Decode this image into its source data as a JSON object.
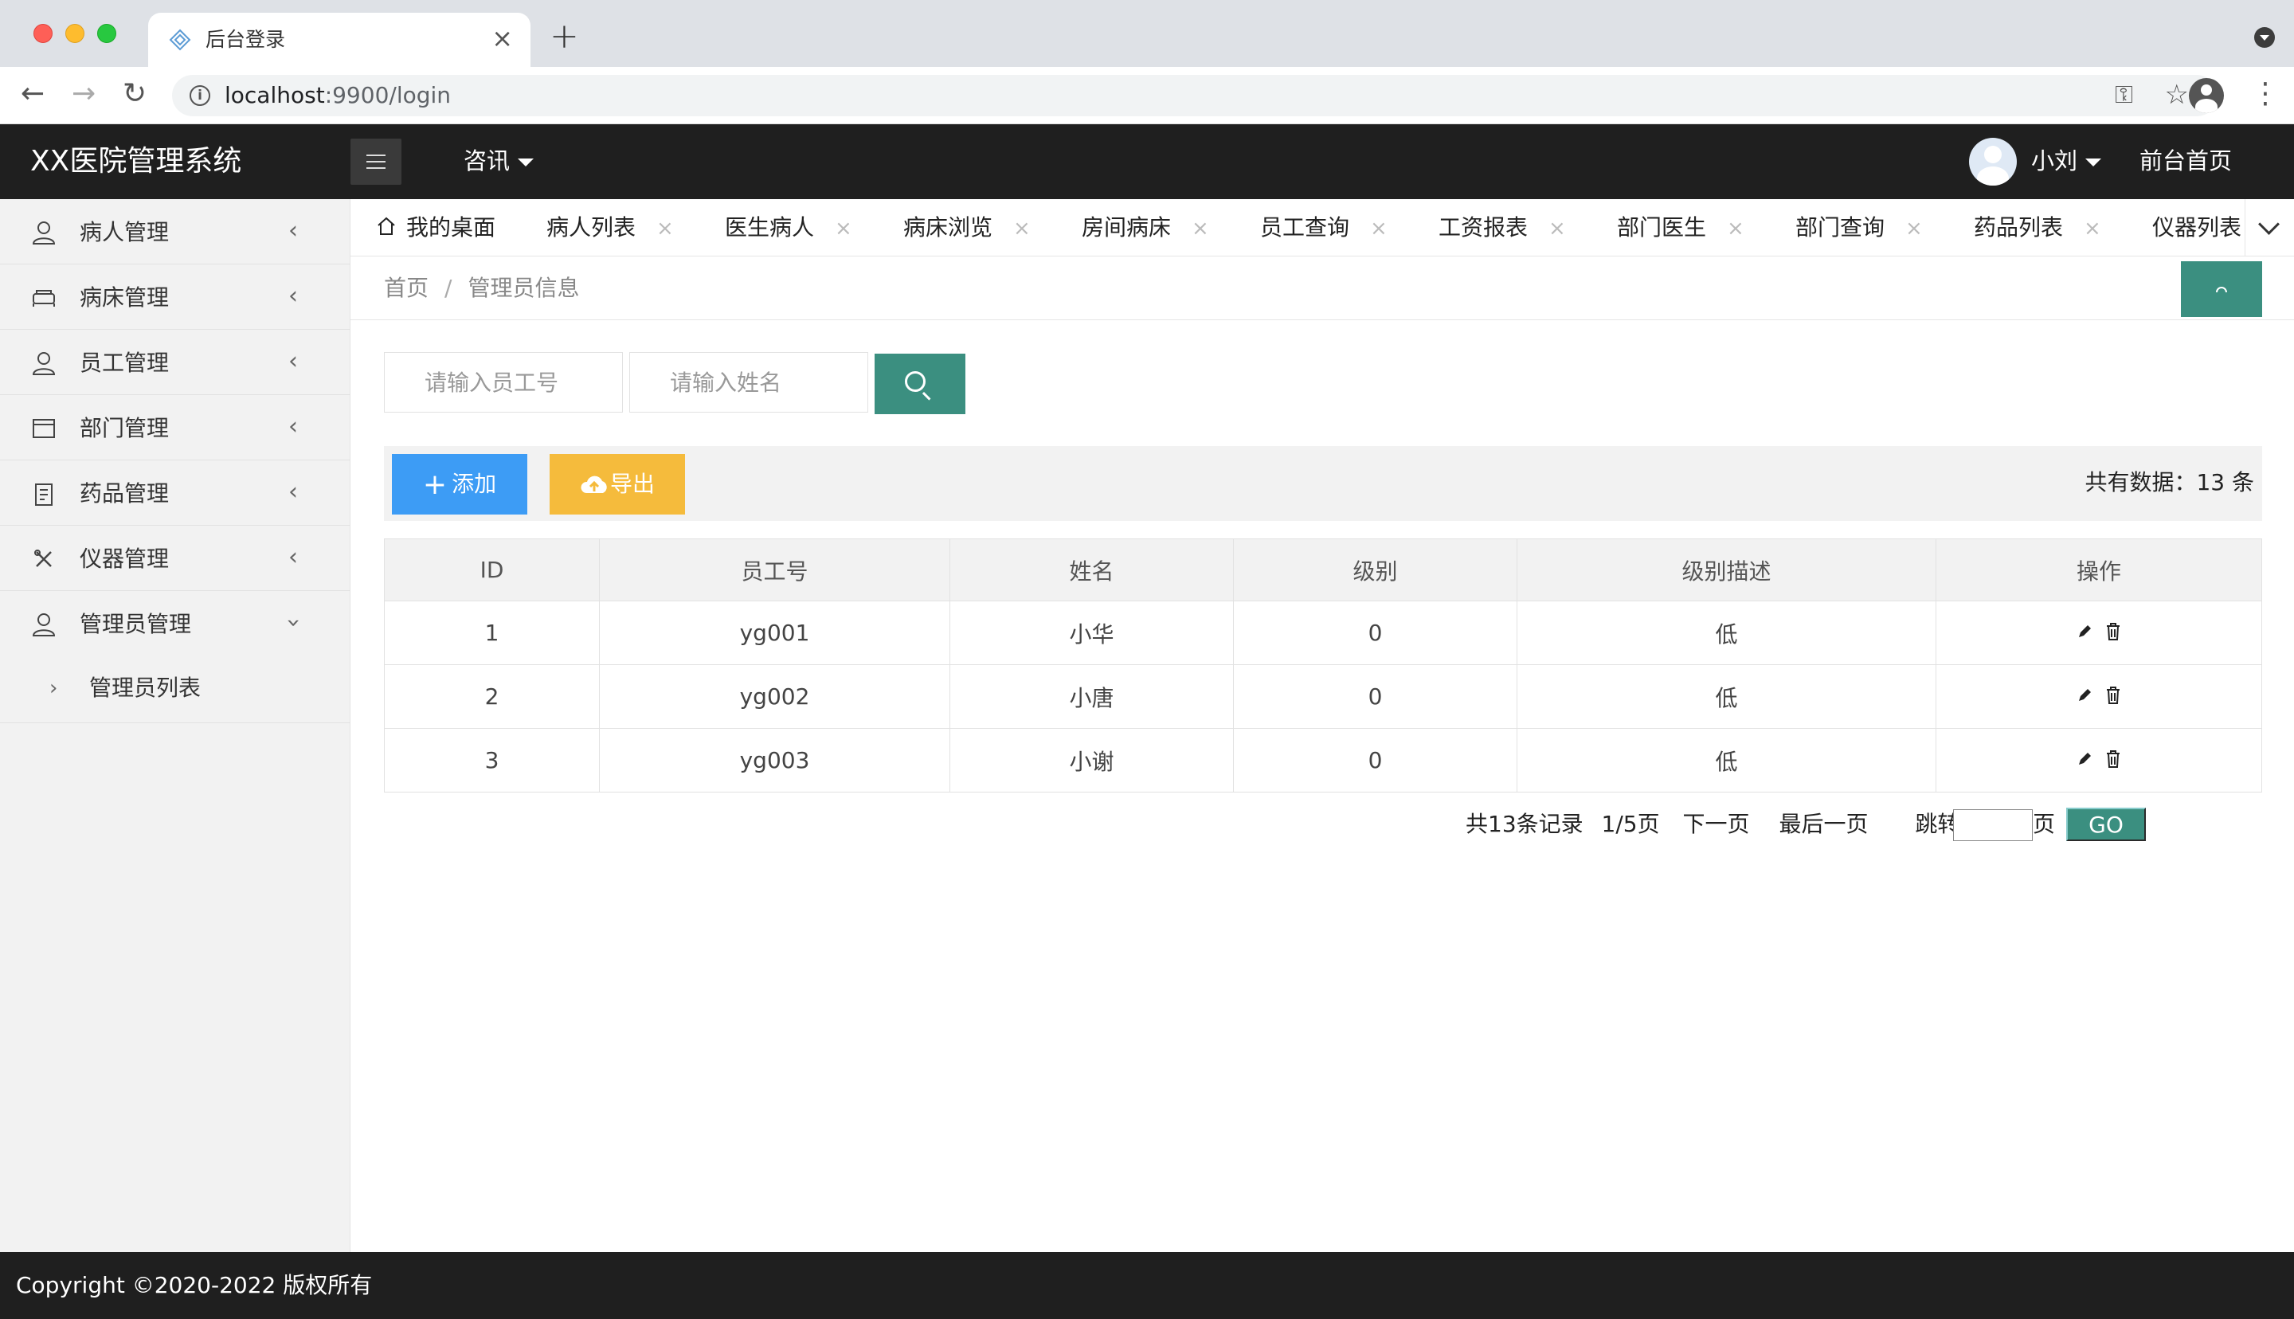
{
  "browser": {
    "tab_title": "后台登录",
    "url_host": "localhost",
    "url_rest": ":9900/login"
  },
  "header": {
    "app_title": "XX医院管理系统",
    "news_menu": "咨讯",
    "user_name": "小刘",
    "front_home": "前台首页"
  },
  "sidebar": {
    "items": [
      {
        "label": "病人管理",
        "icon": "user-icon"
      },
      {
        "label": "病床管理",
        "icon": "bed-icon"
      },
      {
        "label": "员工管理",
        "icon": "staff-icon"
      },
      {
        "label": "部门管理",
        "icon": "department-icon"
      },
      {
        "label": "药品管理",
        "icon": "clipboard-icon"
      },
      {
        "label": "仪器管理",
        "icon": "tools-icon"
      },
      {
        "label": "管理员管理",
        "icon": "admin-icon"
      }
    ],
    "sub_items": [
      {
        "label": "管理员列表"
      }
    ]
  },
  "page_tabs": [
    {
      "label": "我的桌面"
    },
    {
      "label": "病人列表"
    },
    {
      "label": "医生病人"
    },
    {
      "label": "病床浏览"
    },
    {
      "label": "房间病床"
    },
    {
      "label": "员工查询"
    },
    {
      "label": "工资报表"
    },
    {
      "label": "部门医生"
    },
    {
      "label": "部门查询"
    },
    {
      "label": "药品列表"
    },
    {
      "label": "仪器列表"
    }
  ],
  "breadcrumb": {
    "home": "首页",
    "separator": "/",
    "current": "管理员信息"
  },
  "search": {
    "empno_placeholder": "请输入员工号",
    "name_placeholder": "请输入姓名"
  },
  "actions": {
    "add_label": "添加",
    "export_label": "导出",
    "total_label": "共有数据：13 条"
  },
  "table": {
    "headers": [
      "ID",
      "员工号",
      "姓名",
      "级别",
      "级别描述",
      "操作"
    ],
    "rows": [
      [
        "1",
        "yg001",
        "小华",
        "0",
        "低"
      ],
      [
        "2",
        "yg002",
        "小唐",
        "0",
        "低"
      ],
      [
        "3",
        "yg003",
        "小谢",
        "0",
        "低"
      ]
    ]
  },
  "pagination": {
    "records": "共13条记录",
    "page": "1/5页",
    "next": "下一页",
    "last": "最后一页",
    "jump": "跳转至",
    "unit": "页",
    "go": "GO"
  },
  "footer": {
    "copyright": "Copyright ©2020-2022 版权所有"
  },
  "colors": {
    "header_bg": "#1f1f1f",
    "teal": "#3b8f80",
    "add_blue": "#3d9cf5",
    "export_yellow": "#f5bb3c"
  }
}
